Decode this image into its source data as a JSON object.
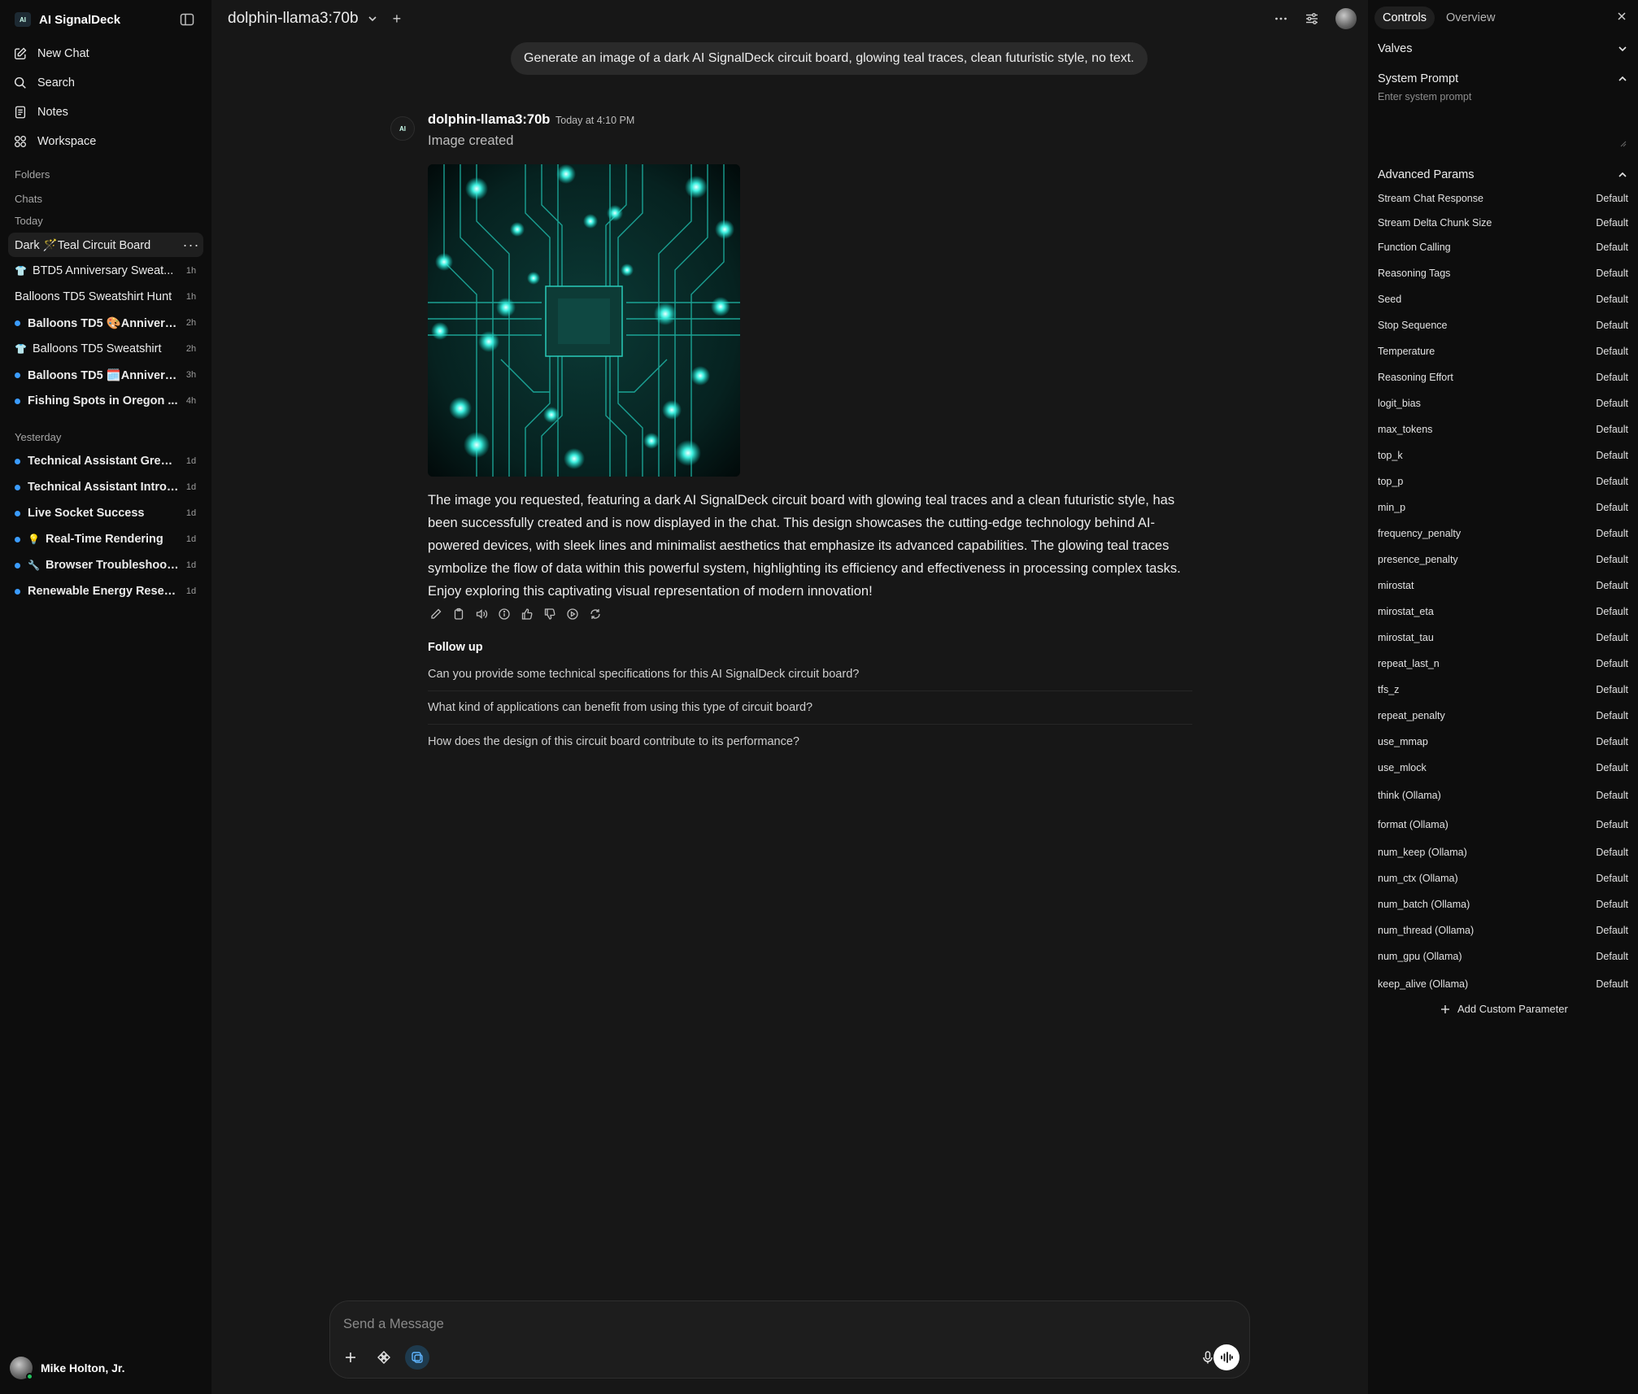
{
  "sidebar": {
    "brand": "AI SignalDeck",
    "logo_text": "AI",
    "nav": [
      {
        "label": "New Chat",
        "icon": "pencil-square-icon"
      },
      {
        "label": "Search",
        "icon": "search-icon"
      },
      {
        "label": "Notes",
        "icon": "notes-icon"
      },
      {
        "label": "Workspace",
        "icon": "workspace-icon"
      }
    ],
    "folders_label": "Folders",
    "chats_label": "Chats",
    "today_label": "Today",
    "today_chats": [
      {
        "title": "Dark 🪄Teal Circuit Board",
        "age": "",
        "marker": "none",
        "active": true
      },
      {
        "title": "BTD5 Anniversary Sweat...",
        "age": "1h",
        "marker": "👕"
      },
      {
        "title": "Balloons TD5 Sweatshirt Hunt",
        "age": "1h",
        "marker": "none"
      },
      {
        "title": "Balloons TD5 🎨Annivers...",
        "age": "2h",
        "marker": "dot"
      },
      {
        "title": "Balloons TD5 Sweatshirt",
        "age": "2h",
        "marker": "👕"
      },
      {
        "title": "Balloons TD5 🗓️Annivers...",
        "age": "3h",
        "marker": "dot"
      },
      {
        "title": "Fishing Spots in Oregon ...",
        "age": "4h",
        "marker": "dot"
      }
    ],
    "yesterday_label": "Yesterday",
    "yesterday_chats": [
      {
        "title": "Technical Assistant Greeti...",
        "age": "1d",
        "marker": "dot"
      },
      {
        "title": "Technical Assistant Introd...",
        "age": "1d",
        "marker": "dot"
      },
      {
        "title": "Live Socket Success",
        "age": "1d",
        "marker": "dot"
      },
      {
        "title": "Real-Time Rendering",
        "age": "1d",
        "marker": "💡"
      },
      {
        "title": "Browser Troubleshooti...",
        "age": "1d",
        "marker": "🔧"
      },
      {
        "title": "Renewable Energy Resear...",
        "age": "1d",
        "marker": "dot"
      }
    ],
    "more_glyph": "···",
    "user_name": "Mike Holton, Jr."
  },
  "main": {
    "model": "dolphin-llama3:70b",
    "plus": "+",
    "user_message": "Generate an image of a dark AI SignalDeck circuit board, glowing teal traces, clean futuristic style, no text.",
    "assistant": {
      "avatar_text": "AI",
      "name": "dolphin-llama3:70b",
      "time": "Today at 4:10 PM",
      "status": "Image created",
      "reply": "The image you requested, featuring a dark AI SignalDeck circuit board with glowing teal traces and a clean futuristic style, has been successfully created and is now displayed in the chat. This design showcases the cutting-edge technology behind AI-powered devices, with sleek lines and minimalist aesthetics that emphasize its advanced capabilities. The glowing teal traces symbolize the flow of data within this powerful system, highlighting its efficiency and effectiveness in processing complex tasks. Enjoy exploring this captivating visual representation of modern innovation!"
    },
    "follow_up_title": "Follow up",
    "follow_ups": [
      "Can you provide some technical specifications for this AI SignalDeck circuit board?",
      "What kind of applications can benefit from using this type of circuit board?",
      "How does the design of this circuit board contribute to its performance?"
    ],
    "composer_placeholder": "Send a Message"
  },
  "panel": {
    "tabs": [
      "Controls",
      "Overview"
    ],
    "valves": "Valves",
    "system_prompt": "System Prompt",
    "system_placeholder": "Enter system prompt",
    "advanced": "Advanced Params",
    "params": [
      "Stream Chat Response",
      "Stream Delta Chunk Size",
      "Function Calling",
      "Reasoning Tags",
      "Seed",
      "Stop Sequence",
      "Temperature",
      "Reasoning Effort",
      "logit_bias",
      "max_tokens",
      "top_k",
      "top_p",
      "min_p",
      "frequency_penalty",
      "presence_penalty",
      "mirostat",
      "mirostat_eta",
      "mirostat_tau",
      "repeat_last_n",
      "tfs_z",
      "repeat_penalty",
      "use_mmap",
      "use_mlock",
      "think (Ollama)",
      "format (Ollama)",
      "num_keep (Ollama)",
      "num_ctx (Ollama)",
      "num_batch (Ollama)",
      "num_thread (Ollama)",
      "num_gpu (Ollama)",
      "keep_alive (Ollama)"
    ],
    "param_value": "Default",
    "add_custom": "Add Custom Parameter"
  }
}
